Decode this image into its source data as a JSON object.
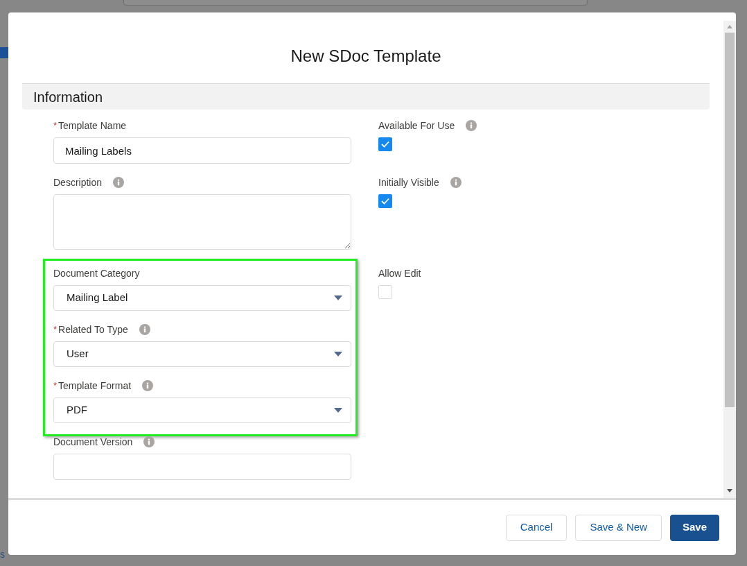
{
  "backdrop": {
    "link_fragment": "s"
  },
  "modal": {
    "title": "New SDoc Template",
    "section": {
      "title": "Information"
    },
    "left_fields": [
      {
        "kind": "text",
        "label": "Template Name",
        "required_mark": "*",
        "value": "Mailing Labels"
      },
      {
        "kind": "textarea",
        "label": "Description",
        "info": true
      },
      {
        "kind": "select",
        "label": "Document Category",
        "value": "Mailing Label",
        "highlighted": true
      },
      {
        "kind": "select",
        "label": "Related To Type",
        "required_mark": "*",
        "info": true,
        "value": "User",
        "highlighted": true
      },
      {
        "kind": "select",
        "label": "Template Format",
        "required_mark": "*",
        "info": true,
        "value": "PDF",
        "highlighted": true
      },
      {
        "kind": "text",
        "label": "Document Version",
        "info": true
      }
    ],
    "right_fields": [
      {
        "label": "Available For Use",
        "info": true,
        "checked": true
      },
      {
        "label": "Initially Visible",
        "info": true,
        "checked": true
      },
      {
        "label": "Allow Edit",
        "checked": false
      }
    ],
    "buttons": [
      {
        "label": "Cancel",
        "kind": "neutral"
      },
      {
        "label": "Save & New",
        "kind": "neutral"
      },
      {
        "label": "Save",
        "kind": "brand"
      }
    ]
  }
}
